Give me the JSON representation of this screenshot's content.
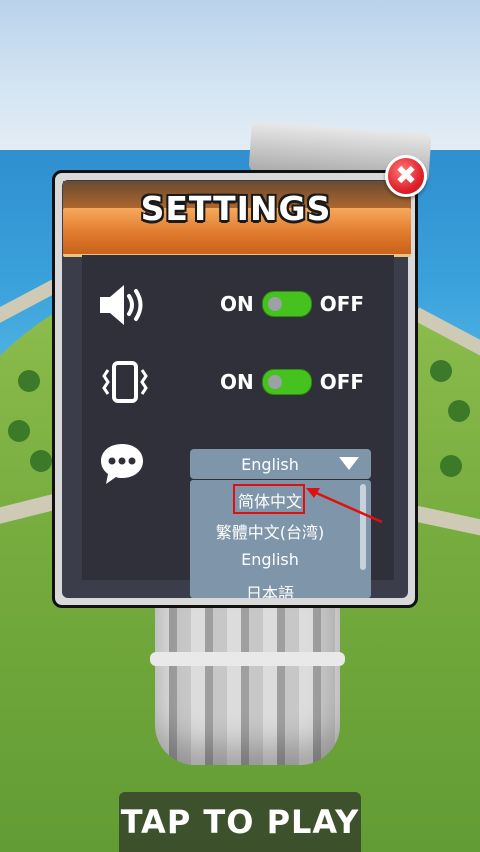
{
  "settings": {
    "title": "SETTINGS",
    "close_label": "✖",
    "sound": {
      "on_label": "ON",
      "off_label": "OFF",
      "state": "ON"
    },
    "vibration": {
      "on_label": "ON",
      "off_label": "OFF",
      "state": "ON"
    },
    "language": {
      "selected": "English",
      "options": [
        "简体中文",
        "繁體中文(台湾)",
        "English",
        "日本語"
      ],
      "highlighted_option": "简体中文"
    }
  },
  "tap_to_play": "TAP TO PLAY",
  "icons": {
    "sound": "speaker-icon",
    "vibration": "vibration-icon",
    "language": "chat-bubble-icon",
    "close": "close-icon",
    "dropdown": "caret-down-icon"
  },
  "colors": {
    "title_bar": "#e07a2c",
    "toggle_on": "#46c21f",
    "close_button": "#e0232b",
    "dropdown_bg": "#7f96aa",
    "annotation": "#e01010"
  }
}
